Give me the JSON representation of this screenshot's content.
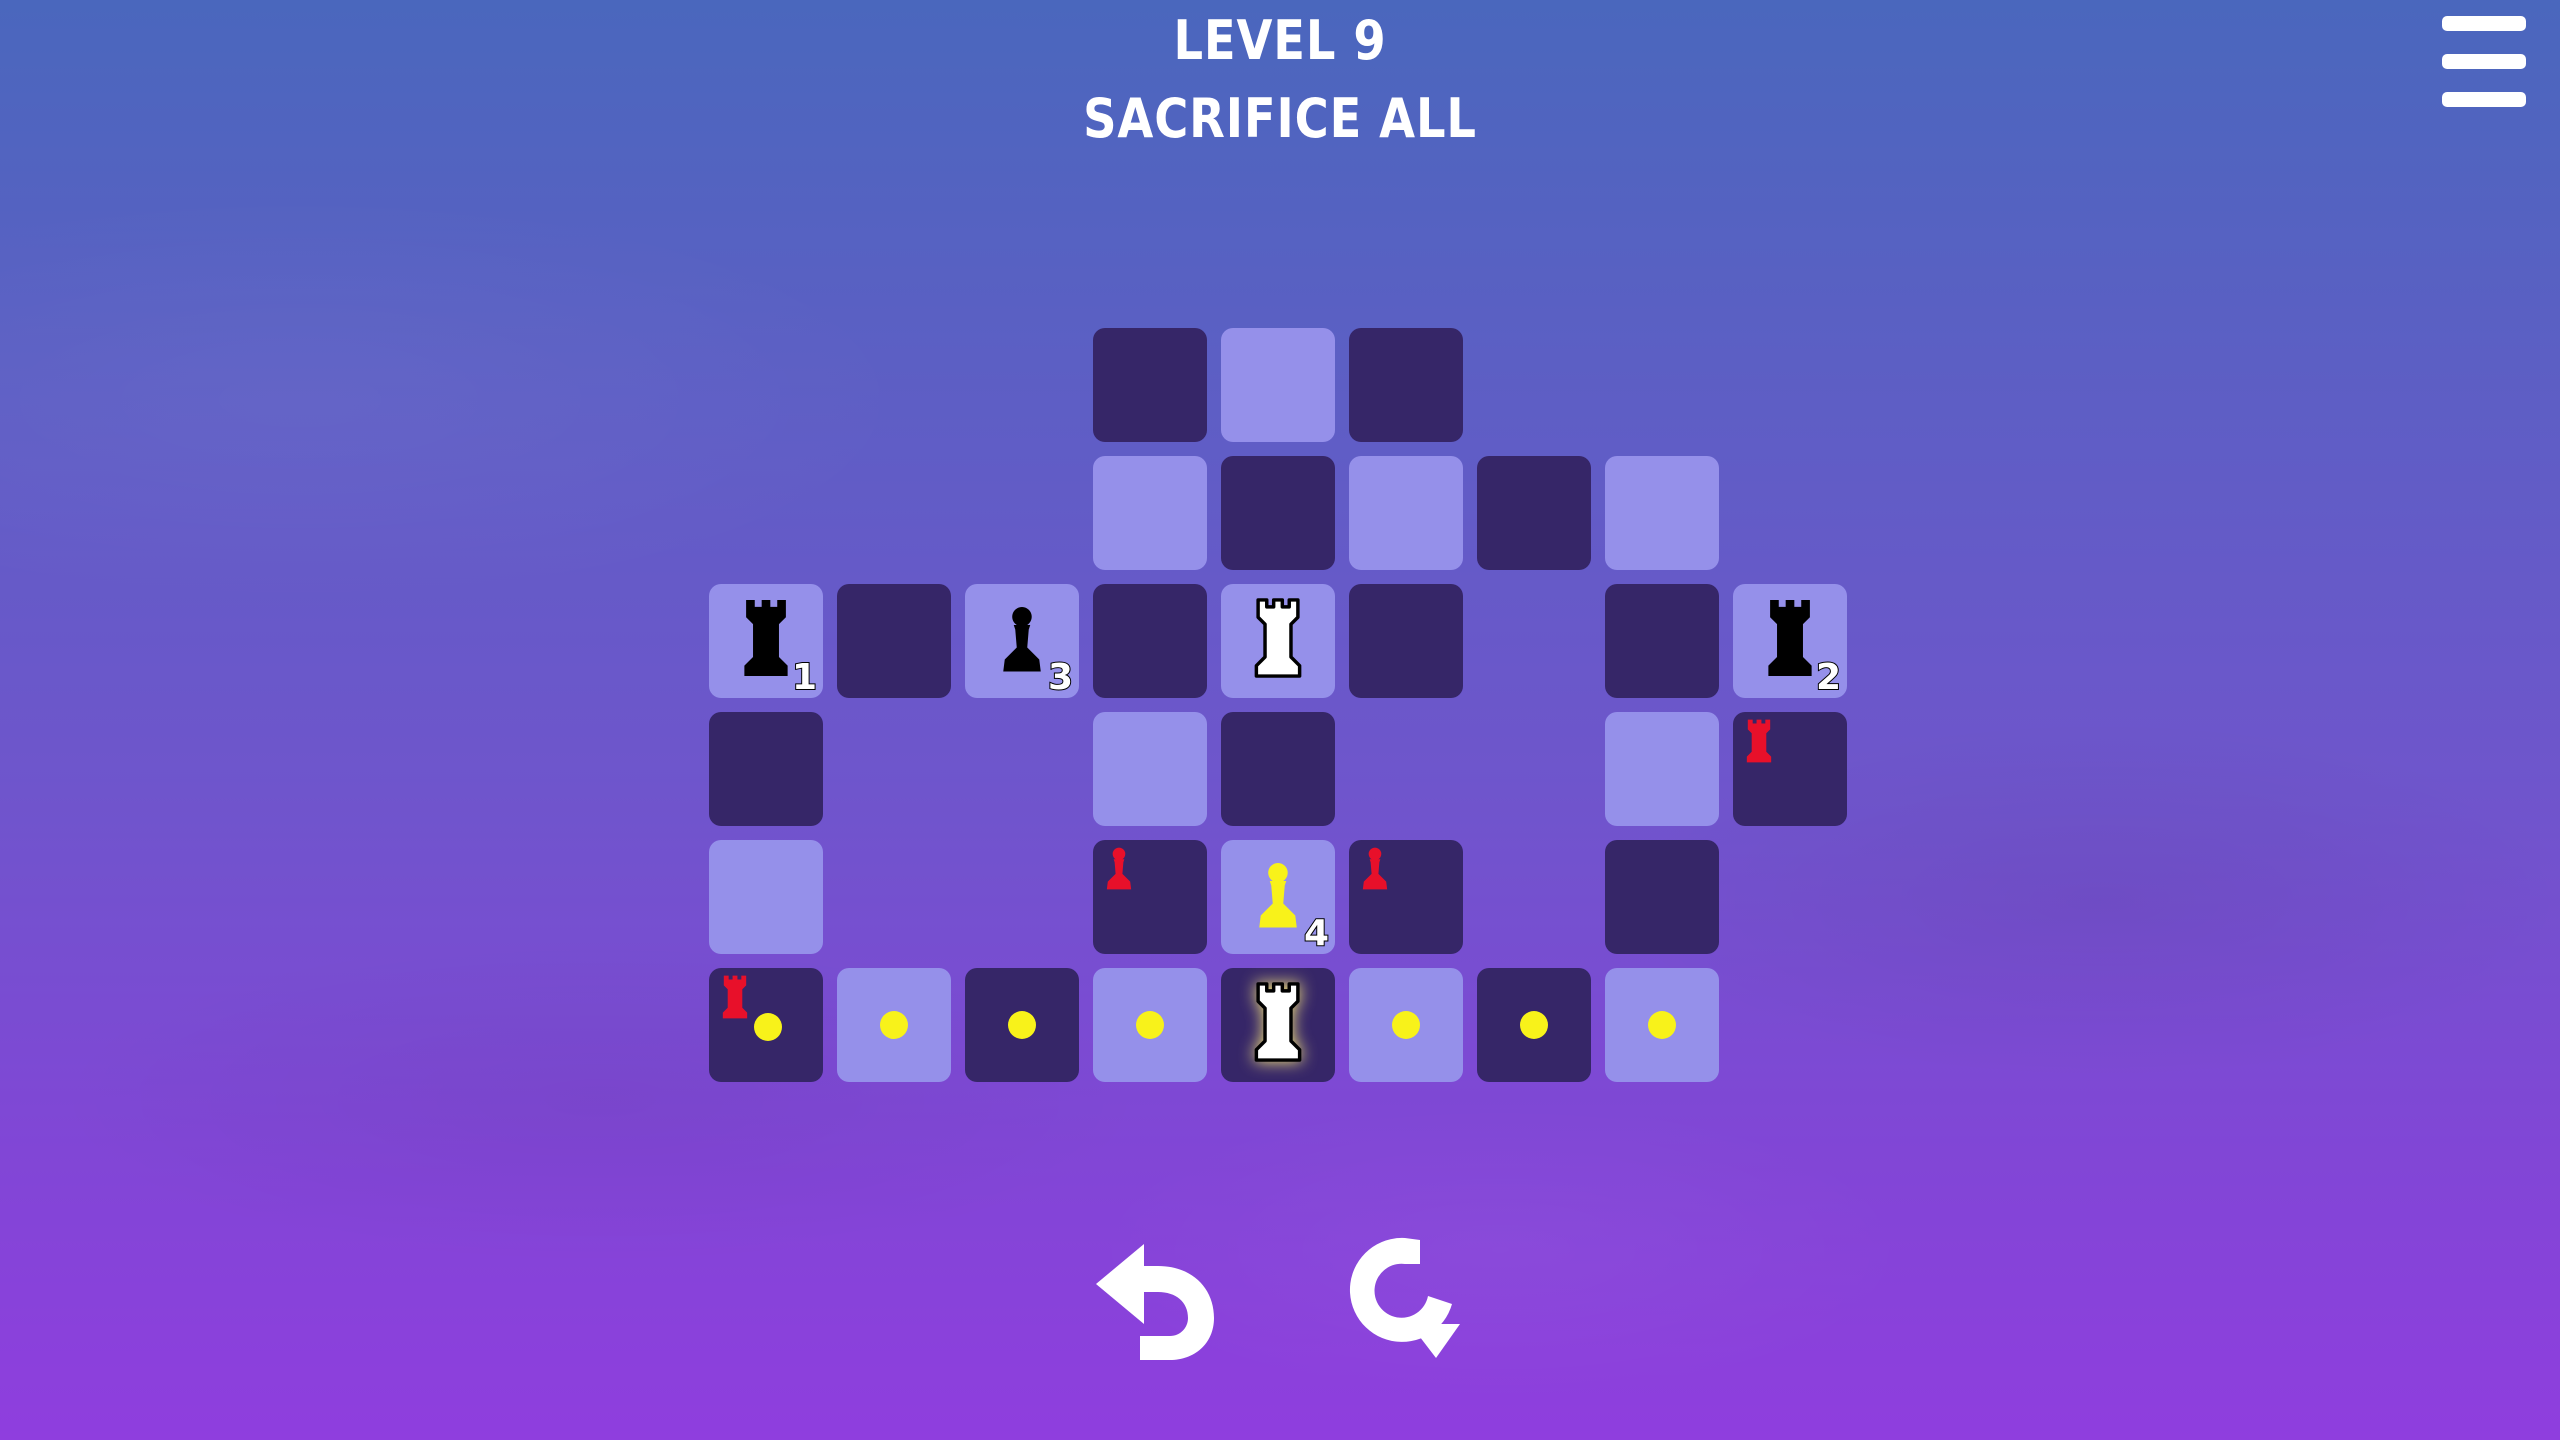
{
  "header": {
    "level": "LEVEL 9",
    "subtitle": "SACRIFICE ALL"
  },
  "menu_icon": "hamburger-menu-icon",
  "controls": {
    "undo_icon": "undo-arrow-icon",
    "restart_icon": "restart-icon"
  },
  "colors": {
    "dark_square": "#362668",
    "light_square": "#9590ea",
    "black_piece": "#000000",
    "white_piece": "#ffffff",
    "enemy_red": "#e8102a",
    "highlight_yellow": "#f8f21a"
  },
  "board": {
    "cells": [
      {
        "col": 3,
        "row": 0,
        "shade": "dark"
      },
      {
        "col": 4,
        "row": 0,
        "shade": "light"
      },
      {
        "col": 5,
        "row": 0,
        "shade": "dark"
      },
      {
        "col": 3,
        "row": 1,
        "shade": "light"
      },
      {
        "col": 4,
        "row": 1,
        "shade": "dark"
      },
      {
        "col": 5,
        "row": 1,
        "shade": "light"
      },
      {
        "col": 6,
        "row": 1,
        "shade": "dark"
      },
      {
        "col": 7,
        "row": 1,
        "shade": "light"
      },
      {
        "col": 0,
        "row": 2,
        "shade": "light",
        "piece": {
          "type": "rook",
          "color": "black",
          "number": "1"
        }
      },
      {
        "col": 1,
        "row": 2,
        "shade": "dark"
      },
      {
        "col": 2,
        "row": 2,
        "shade": "light",
        "piece": {
          "type": "pawn",
          "color": "black",
          "number": "3"
        }
      },
      {
        "col": 3,
        "row": 2,
        "shade": "dark"
      },
      {
        "col": 4,
        "row": 2,
        "shade": "light",
        "piece": {
          "type": "rook",
          "color": "white"
        }
      },
      {
        "col": 5,
        "row": 2,
        "shade": "dark"
      },
      {
        "col": 7,
        "row": 2,
        "shade": "dark"
      },
      {
        "col": 8,
        "row": 2,
        "shade": "light",
        "piece": {
          "type": "rook",
          "color": "black",
          "number": "2"
        }
      },
      {
        "col": 0,
        "row": 3,
        "shade": "dark"
      },
      {
        "col": 3,
        "row": 3,
        "shade": "light"
      },
      {
        "col": 4,
        "row": 3,
        "shade": "dark"
      },
      {
        "col": 7,
        "row": 3,
        "shade": "light"
      },
      {
        "col": 8,
        "row": 3,
        "shade": "dark",
        "marker": "rook"
      },
      {
        "col": 0,
        "row": 4,
        "shade": "light"
      },
      {
        "col": 3,
        "row": 4,
        "shade": "dark",
        "marker": "pawn"
      },
      {
        "col": 4,
        "row": 4,
        "shade": "light",
        "piece": {
          "type": "pawn",
          "color": "yellow",
          "number": "4"
        }
      },
      {
        "col": 5,
        "row": 4,
        "shade": "dark",
        "marker": "pawn"
      },
      {
        "col": 7,
        "row": 4,
        "shade": "dark"
      },
      {
        "col": 0,
        "row": 5,
        "shade": "dark",
        "marker": "rook",
        "dot": true
      },
      {
        "col": 1,
        "row": 5,
        "shade": "light",
        "dot": true
      },
      {
        "col": 2,
        "row": 5,
        "shade": "dark",
        "dot": true
      },
      {
        "col": 3,
        "row": 5,
        "shade": "light",
        "dot": true
      },
      {
        "col": 4,
        "row": 5,
        "shade": "dark",
        "piece": {
          "type": "rook",
          "color": "white",
          "selected": true
        }
      },
      {
        "col": 5,
        "row": 5,
        "shade": "light",
        "dot": true
      },
      {
        "col": 6,
        "row": 5,
        "shade": "dark",
        "dot": true
      },
      {
        "col": 7,
        "row": 5,
        "shade": "light",
        "dot": true
      }
    ]
  }
}
